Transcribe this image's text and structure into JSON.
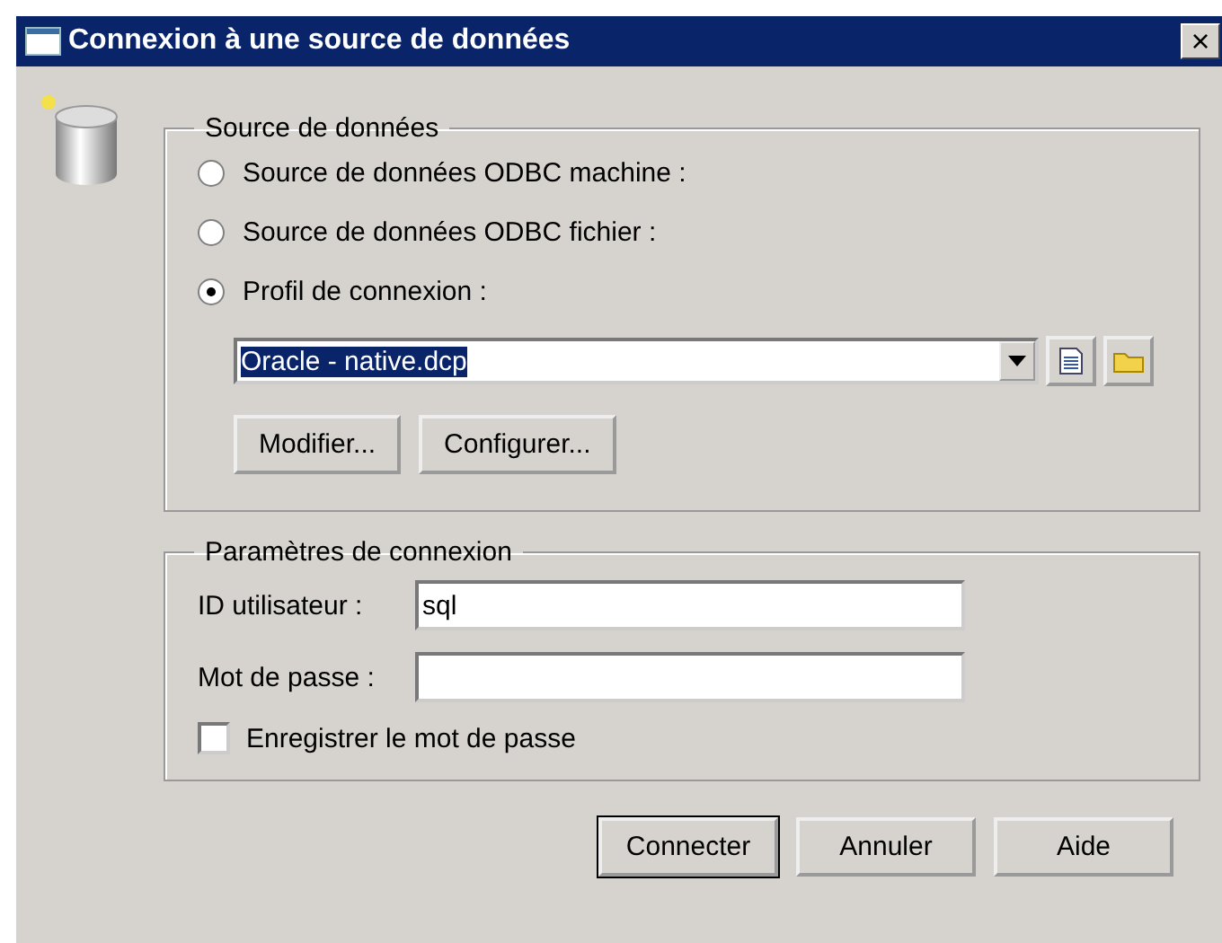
{
  "window": {
    "title": "Connexion à une source de données",
    "close": "×"
  },
  "source_group": {
    "legend": "Source de données",
    "options": [
      {
        "label": "Source de données ODBC machine :",
        "selected": false
      },
      {
        "label": "Source de données ODBC fichier :",
        "selected": false
      },
      {
        "label": "Profil de connexion :",
        "selected": true
      }
    ],
    "profile": {
      "value": "Oracle - native.dcp"
    },
    "buttons": [
      "Modifier...",
      "Configurer..."
    ]
  },
  "params_group": {
    "legend": "Paramètres de connexion",
    "fields": [
      {
        "label": "ID utilisateur :",
        "value": "sql"
      },
      {
        "label": "Mot de passe :"
      }
    ],
    "save_password": {
      "label": "Enregistrer le mot de passe",
      "checked": false
    }
  },
  "buttons": [
    {
      "label": "Connecter",
      "default": true
    },
    {
      "label": "Annuler",
      "default": false
    },
    {
      "label": "Aide",
      "default": false
    }
  ]
}
